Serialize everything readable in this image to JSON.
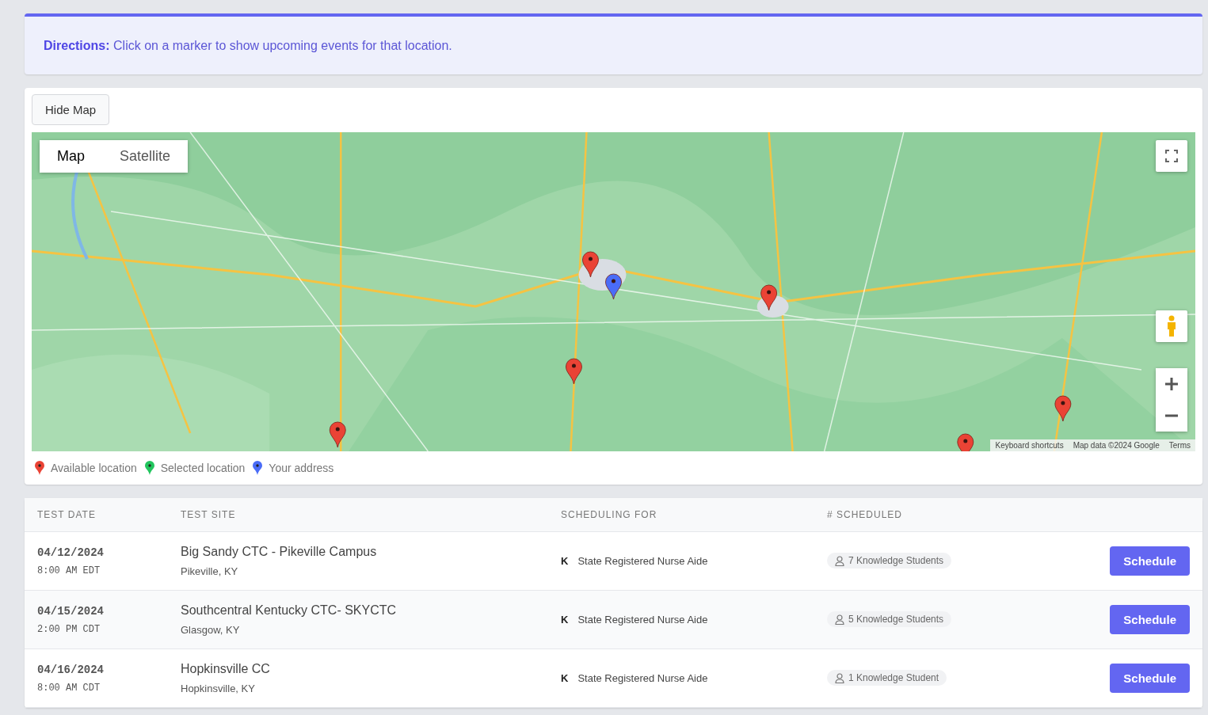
{
  "directions": {
    "label": "Directions:",
    "text": "Click on a marker to show upcoming events for that location."
  },
  "map_panel": {
    "toggle_button": "Hide Map",
    "map_types": [
      {
        "label": "Map",
        "selected": true
      },
      {
        "label": "Satellite",
        "selected": false
      }
    ],
    "map": {
      "kind": "picture"
    },
    "attribution": [
      "Keyboard shortcuts",
      "Map data ©2024 Google",
      "Terms"
    ],
    "legend": [
      {
        "label": "Available location",
        "color": "#ea4335"
      },
      {
        "label": "Selected location",
        "color": "#22c55e"
      },
      {
        "label": "Your address",
        "color": "#4a6cf7"
      }
    ]
  },
  "table": {
    "columns": [
      "TEST DATE",
      "TEST SITE",
      "SCHEDULING FOR",
      "# SCHEDULED"
    ],
    "rows": [
      {
        "date": "04/12/2024",
        "time": "8:00 AM EDT",
        "site": "Big Sandy CTC - Pikeville Campus",
        "city": "Pikeville, KY",
        "type_letter": "K",
        "program": "State Registered Nurse Aide",
        "scheduled": "7 Knowledge Students",
        "action": "Schedule"
      },
      {
        "date": "04/15/2024",
        "time": "2:00 PM CDT",
        "site": "Southcentral Kentucky CTC- SKYCTC",
        "city": "Glasgow, KY",
        "type_letter": "K",
        "program": "State Registered Nurse Aide",
        "scheduled": "5 Knowledge Students",
        "action": "Schedule"
      },
      {
        "date": "04/16/2024",
        "time": "8:00 AM CDT",
        "site": "Hopkinsville CC",
        "city": "Hopkinsville, KY",
        "type_letter": "K",
        "program": "State Registered Nurse Aide",
        "scheduled": "1 Knowledge Student",
        "action": "Schedule"
      }
    ]
  }
}
